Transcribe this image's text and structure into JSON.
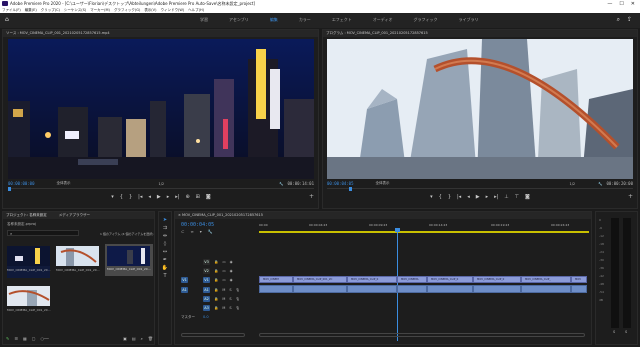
{
  "window": {
    "title": "Adobe Premiere Pro 2020 - [C:\\ユーザー\\Florian\\デスクトップ\\Abteilungen\\Adobe Premiere Pro Auto-Save\\名称未設定_project]",
    "controls": [
      "—",
      "☐",
      "✕"
    ]
  },
  "menu": [
    "ファイル(F)",
    "編集(E)",
    "クリップ(C)",
    "シーケンス(S)",
    "マーカー(M)",
    "グラフィック(G)",
    "表示(V)",
    "ウィンドウ(W)",
    "ヘルプ(H)"
  ],
  "workspaces": [
    "学習",
    "アセンブリ",
    "編集",
    "カラー",
    "エフェクト",
    "オーディオ",
    "グラフィック",
    "ライブラリ"
  ],
  "workspace_active": "編集",
  "source": {
    "tab": "ソース : MOV_CINEMA_CLIP_001_20210205172857615.mp4",
    "timecode_left": "00:00:00:00",
    "fit": "全体表示",
    "quality": "1/2",
    "timecode_right": "00:00:14:01"
  },
  "program": {
    "tab": "プログラム : MOV_CINEMA_CLIP_001_20210205172857615",
    "timecode_left": "00:00:04:05",
    "fit": "全体表示",
    "quality": "1/2",
    "timecode_right": "00:00:20:00"
  },
  "project": {
    "tabs": [
      "プロジェクト: 名称未設定",
      "メディアブラウザー"
    ],
    "file": "名称未設定.prproj",
    "selection": "1 個のアイテム (4 個のアイテムを選択)",
    "clips": [
      "MOV_CINEMA_CLIP_001_20...",
      "MOV_CINEMA_CLIP_001_20...",
      "MOV_CINEMA_CLIP_001_20...",
      "MOV_CINEMA_CLIP_001_20..."
    ]
  },
  "timeline": {
    "tab": "MOV_CINEMA_CLIP_001_20210205172857615",
    "timecode": "00:00:04:05",
    "ruler": [
      "00:00",
      "00:00:04:23",
      "00:00:09:23",
      "00:00:14:23",
      "00:00:19:23",
      "00:00:24:23",
      "00:00:29:23"
    ],
    "video_tracks": [
      "V3",
      "V2",
      "V1"
    ],
    "audio_tracks": [
      "A1",
      "A2",
      "A3"
    ],
    "master": "マスター",
    "master_value": "0.0",
    "v1_clips": [
      "MOV_CINEM",
      "MOV_CINEMA_CLIP_001_2C",
      "MOV_CINEMA_CLIP_0",
      "MOV_CINEMA",
      "MOV_CINEMA_CLIP_0",
      "MOV_CINEMA_CLIP_0",
      "MOV_CINEMA_CLIP_",
      "MOV"
    ]
  },
  "meter": {
    "labels": [
      "S",
      "S"
    ],
    "scale": [
      "0",
      "-6",
      "-12",
      "-18",
      "-24",
      "-30",
      "-36",
      "-42",
      "-48",
      "-54",
      "dB"
    ]
  }
}
